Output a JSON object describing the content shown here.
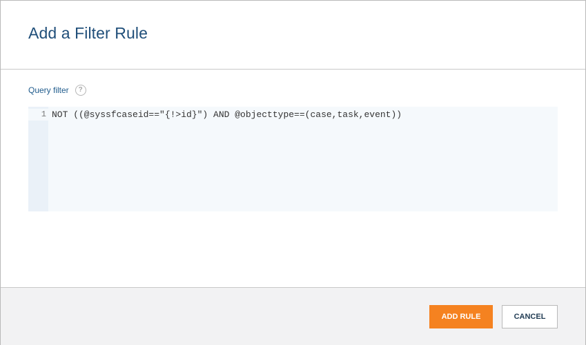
{
  "dialog": {
    "title": "Add a Filter Rule"
  },
  "query_filter": {
    "label": "Query filter",
    "help_icon": "question-circle-icon",
    "help_glyph": "?",
    "lines": [
      {
        "number": "1",
        "code": "NOT ((@syssfcaseid==\"{!>id}\") AND @objecttype==(case,task,event))"
      }
    ]
  },
  "footer": {
    "add_rule_label": "ADD RULE",
    "cancel_label": "CANCEL"
  },
  "colors": {
    "title": "#1f4e79",
    "primary_button": "#f58220",
    "editor_background": "#f5f9fc",
    "gutter_background": "#eaf1f8",
    "footer_background": "#f2f2f3"
  }
}
